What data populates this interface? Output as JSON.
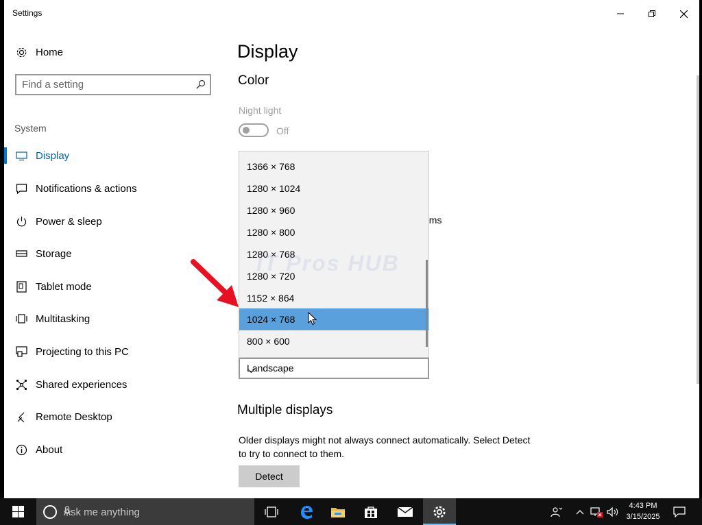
{
  "window": {
    "title": "Settings"
  },
  "sidebar": {
    "home_label": "Home",
    "search_placeholder": "Find a setting",
    "section_label": "System",
    "items": [
      {
        "label": "Display",
        "icon": "monitor-icon",
        "active": true
      },
      {
        "label": "Notifications & actions",
        "icon": "message-icon"
      },
      {
        "label": "Power & sleep",
        "icon": "power-icon"
      },
      {
        "label": "Storage",
        "icon": "storage-icon"
      },
      {
        "label": "Tablet mode",
        "icon": "tablet-icon"
      },
      {
        "label": "Multitasking",
        "icon": "multitasking-icon"
      },
      {
        "label": "Projecting to this PC",
        "icon": "projector-icon"
      },
      {
        "label": "Shared experiences",
        "icon": "share-icon"
      },
      {
        "label": "Remote Desktop",
        "icon": "remote-icon"
      },
      {
        "label": "About",
        "icon": "info-icon"
      }
    ]
  },
  "main": {
    "title": "Display",
    "color_heading": "Color",
    "night_light_label": "Night light",
    "night_light_state": "Off",
    "partial_text": "ems",
    "resolution_options": [
      "1366 × 768",
      "1280 × 1024",
      "1280 × 960",
      "1280 × 800",
      "1280 × 768",
      "1280 × 720",
      "1152 × 864",
      "1024 × 768",
      "800 × 600"
    ],
    "resolution_selected": "1024 × 768",
    "watermark": "IT Pros HUB",
    "orientation_value": "Landscape",
    "multiple_displays_heading": "Multiple displays",
    "multiple_displays_desc": "Older displays might not always connect automatically. Select Detect to try to connect to them.",
    "detect_label": "Detect"
  },
  "taskbar": {
    "search_placeholder": "Ask me anything",
    "time": "4:43 PM",
    "date": "3/15/2025"
  },
  "colors": {
    "accent": "#0078d7",
    "selected_item": "#5aa0dc",
    "arrow": "#e81123"
  }
}
